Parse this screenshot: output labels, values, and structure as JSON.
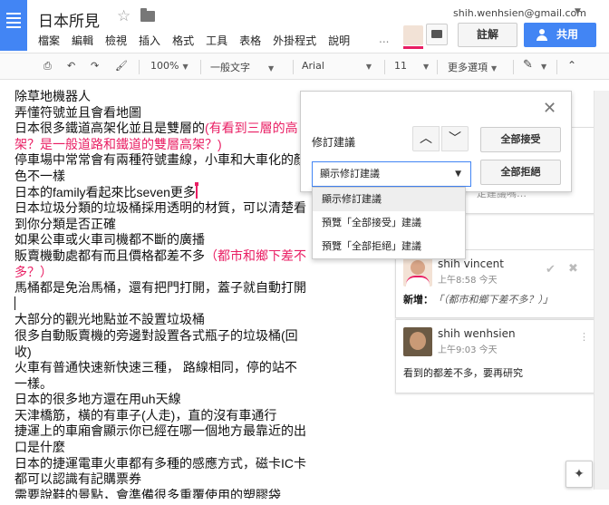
{
  "header": {
    "title": "日本所見",
    "account": "shih.wenhsien@gmail.com",
    "menu": [
      "檔案",
      "編輯",
      "檢視",
      "插入",
      "格式",
      "工具",
      "表格",
      "外掛程式",
      "說明"
    ],
    "more": "...",
    "comment_label": "註解",
    "share_label": "共用",
    "accent": "#4285f4"
  },
  "toolbar": {
    "zoom": "100%",
    "style": "一般文字",
    "font": "Arial",
    "size": "11",
    "more": "更多選項"
  },
  "document": {
    "lines": [
      {
        "text": "除草地機器人"
      },
      {
        "text": "弄懂符號並且會看地圖"
      },
      {
        "text": "日本很多鐵道高架化並且是雙層的",
        "suggestion": "(有看到三層的高架？是一般道路和鐵道的雙層高架？)"
      },
      {
        "text": "停車場中常常會有兩種符號畫線，小車和大車化的顏色不一樣"
      },
      {
        "text": "日本的family看起來比seven更多"
      },
      {
        "text": "日本垃圾分類的垃圾桶採用透明的材質，可以清楚看到你分類是否正確"
      },
      {
        "text": "如果公車或火車司機都不斷的廣播"
      },
      {
        "text": "販賣機動處都有而且價格都差不多",
        "suggestion": "（都市和鄉下差不多？）"
      },
      {
        "text": "馬桶都是免治馬桶，還有把門打開，蓋子就自動打開"
      },
      {
        "text": "大部分的觀光地點並不設置垃圾桶"
      },
      {
        "text": "很多自動販賣機的旁邊對設置各式瓶子的垃圾桶(回收)"
      },
      {
        "text": "火車有普通快速新快速三種， 路線相同，停的站不一樣。"
      },
      {
        "text": "日本的很多地方還在用uh天線"
      },
      {
        "text": "天津橋筋，橫的有車子(人走)，直的沒有車通行"
      },
      {
        "text": "捷運上的車廂會顯示你已經在哪一個地方最靠近的出口是什麼"
      },
      {
        "text": "日本的捷運電車火車都有多種的感應方式，磁卡IC卡都可以認識有記購票券"
      },
      {
        "text": "需要說鞋的景點，會準備很多重覆使用的塑膠袋"
      },
      {
        "text": "----------------------------------------------------"
      }
    ],
    "suggestion_color": "#e91e63"
  },
  "suggest_panel": {
    "title": "修訂建議",
    "accept_all": "全部接受",
    "reject_all": "全部拒絕",
    "mode_selected": "顯示修訂建議",
    "mode_options": [
      "顯示修訂建議",
      "預覽「全部接受」建議",
      "預覽「全部拒絕」建議"
    ]
  },
  "comments": {
    "card1_tail": "定建議嗎…",
    "suggestion_comment": {
      "author": "shih vincent",
      "time": "上午8:58 今天",
      "label": "新增：",
      "text": "「（都市和鄉下差不多？）」"
    },
    "comment": {
      "author": "shih wenhsien",
      "time": "上午9:03 今天",
      "text": "看到的都差不多，要再研究"
    }
  }
}
